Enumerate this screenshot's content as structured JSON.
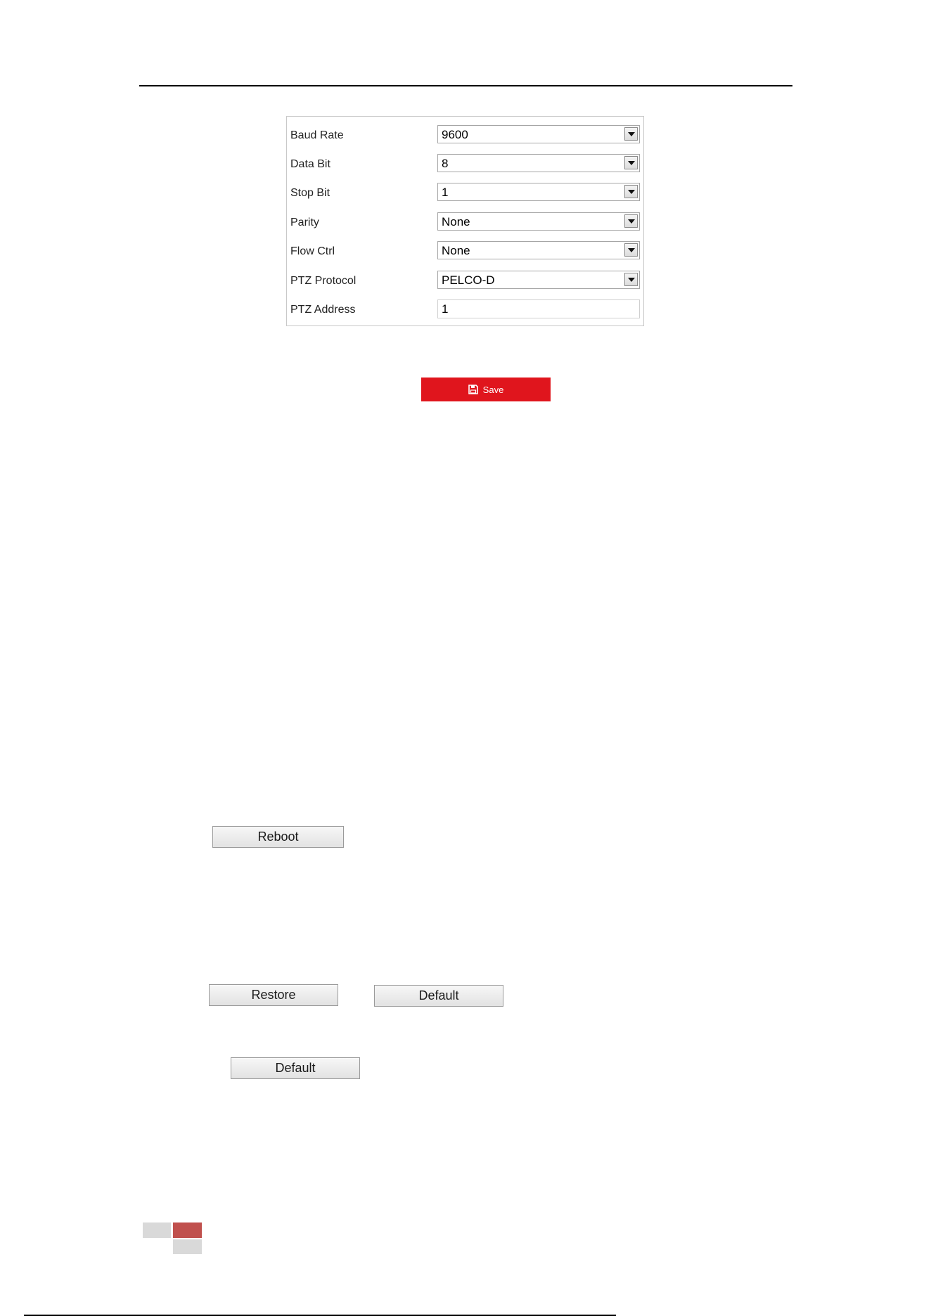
{
  "serial_settings": {
    "rows": [
      {
        "label": "Baud Rate",
        "value": "9600",
        "kind": "select"
      },
      {
        "label": "Data Bit",
        "value": "8",
        "kind": "select"
      },
      {
        "label": "Stop Bit",
        "value": "1",
        "kind": "select"
      },
      {
        "label": "Parity",
        "value": "None",
        "kind": "select"
      },
      {
        "label": "Flow Ctrl",
        "value": "None",
        "kind": "select"
      },
      {
        "label": "PTZ Protocol",
        "value": "PELCO-D",
        "kind": "select"
      },
      {
        "label": "PTZ Address",
        "value": "1",
        "kind": "input"
      }
    ]
  },
  "save_button": {
    "label": "Save",
    "icon": "floppy-disk-icon",
    "color": "#e0151d"
  },
  "reboot_button": {
    "label": "Reboot"
  },
  "restore_button": {
    "label": "Restore"
  },
  "default_button_1": {
    "label": "Default"
  },
  "default_button_2": {
    "label": "Default"
  },
  "decor_colors": {
    "gray": "#d9d9d9",
    "red": "#c0504d"
  }
}
